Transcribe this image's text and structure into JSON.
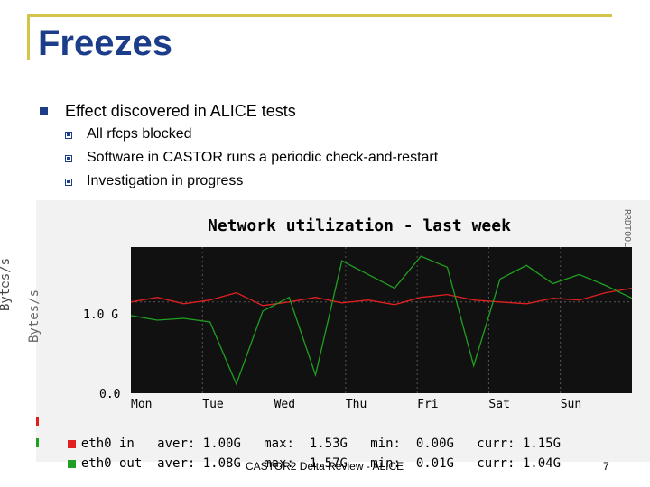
{
  "slide": {
    "title": "Freezes",
    "main_bullet": "Effect discovered in ALICE tests",
    "sub_bullets": [
      "All rfcps blocked",
      "Software in CASTOR runs a periodic check-and-restart",
      "Investigation in progress"
    ],
    "footer": "CASTOR2 Delta Review - ALICE",
    "page_number": "7"
  },
  "colors": {
    "title": "#1c3d8a",
    "frame": "#d4c44a",
    "in": "#e02020",
    "out": "#20a020",
    "plot_bg": "#111111"
  },
  "graph": {
    "ylabel_ghost": "Bytes/s",
    "ylabel": "Bytes/s",
    "watermark": "RRDTOOL / TOBI OETIKER"
  },
  "chart_data": {
    "type": "line",
    "title": "Network utilization - last week",
    "ylabel": "Bytes/s",
    "categories": [
      "Mon",
      "Tue",
      "Wed",
      "Thu",
      "Fri",
      "Sat",
      "Sun"
    ],
    "yticks": [
      "1.0 G",
      "0.0"
    ],
    "ylim": [
      0,
      1.6
    ],
    "series": [
      {
        "name": "eth0 in",
        "color": "#e02020",
        "stats": {
          "aver_label": "aver:",
          "aver": "1.00G",
          "max_label": "max:",
          "max": "1.53G",
          "min_label": "min:",
          "min": "0.00G",
          "curr_label": "curr:",
          "curr": "1.15G"
        },
        "values": [
          1.0,
          1.05,
          0.98,
          1.02,
          1.1,
          0.96,
          1.0,
          1.05,
          0.99,
          1.02,
          0.97,
          1.05,
          1.08,
          1.02,
          1.0,
          0.98,
          1.04,
          1.02,
          1.1,
          1.15
        ]
      },
      {
        "name": "eth0 out",
        "color": "#20a020",
        "stats": {
          "aver_label": "aver:",
          "aver": "1.08G",
          "max_label": "max:",
          "max": "1.57G",
          "min_label": "min:",
          "min": "0.01G",
          "curr_label": "curr:",
          "curr": "1.04G"
        },
        "values": [
          0.85,
          0.8,
          0.82,
          0.78,
          0.1,
          0.9,
          1.05,
          0.2,
          1.45,
          1.3,
          1.15,
          1.5,
          1.38,
          0.3,
          1.25,
          1.4,
          1.2,
          1.3,
          1.18,
          1.04
        ]
      }
    ]
  }
}
